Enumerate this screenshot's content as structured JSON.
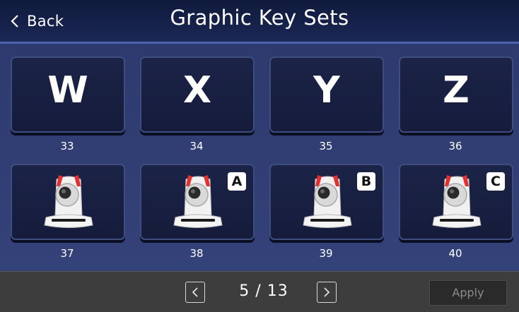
{
  "header": {
    "back_label": "Back",
    "title": "Graphic Key Sets"
  },
  "tiles": [
    {
      "label": "33",
      "type": "letter",
      "letter": "W",
      "badge": ""
    },
    {
      "label": "34",
      "type": "letter",
      "letter": "X",
      "badge": ""
    },
    {
      "label": "35",
      "type": "letter",
      "letter": "Y",
      "badge": ""
    },
    {
      "label": "36",
      "type": "letter",
      "letter": "Z",
      "badge": ""
    },
    {
      "label": "37",
      "type": "camera",
      "icon": "ptz-camera-icon",
      "letter": "",
      "badge": ""
    },
    {
      "label": "38",
      "type": "camera",
      "icon": "ptz-camera-icon",
      "letter": "",
      "badge": "A"
    },
    {
      "label": "39",
      "type": "camera",
      "icon": "ptz-camera-icon",
      "letter": "",
      "badge": "B"
    },
    {
      "label": "40",
      "type": "camera",
      "icon": "ptz-camera-icon",
      "letter": "",
      "badge": "C"
    }
  ],
  "footer": {
    "page_indicator": "5 / 13",
    "apply_label": "Apply",
    "apply_enabled": false
  },
  "colors": {
    "background": "#2f3c70",
    "header": "#131d42",
    "tile": "#1a2245",
    "footer": "#3d3d3d",
    "camera_accent": "#e03030"
  }
}
